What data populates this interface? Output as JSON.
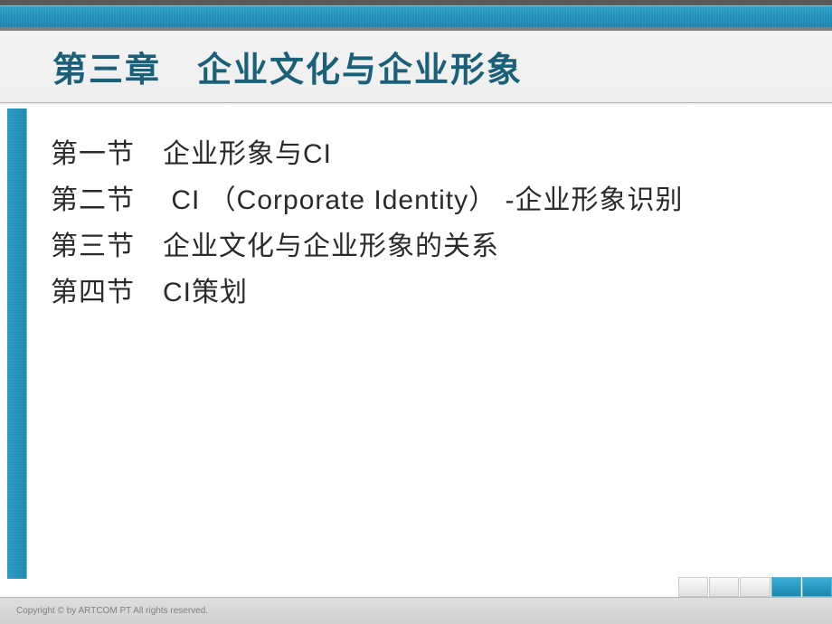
{
  "title": "第三章　企业文化与企业形象",
  "sections": [
    "第一节　企业形象与CI",
    "第二节　 CI （Corporate  Identity） ‐企业形象识别",
    "第三节　企业文化与企业形象的关系",
    "第四节　CI策划"
  ],
  "footer": "Copyright © by ARTCOM PT All rights reserved."
}
